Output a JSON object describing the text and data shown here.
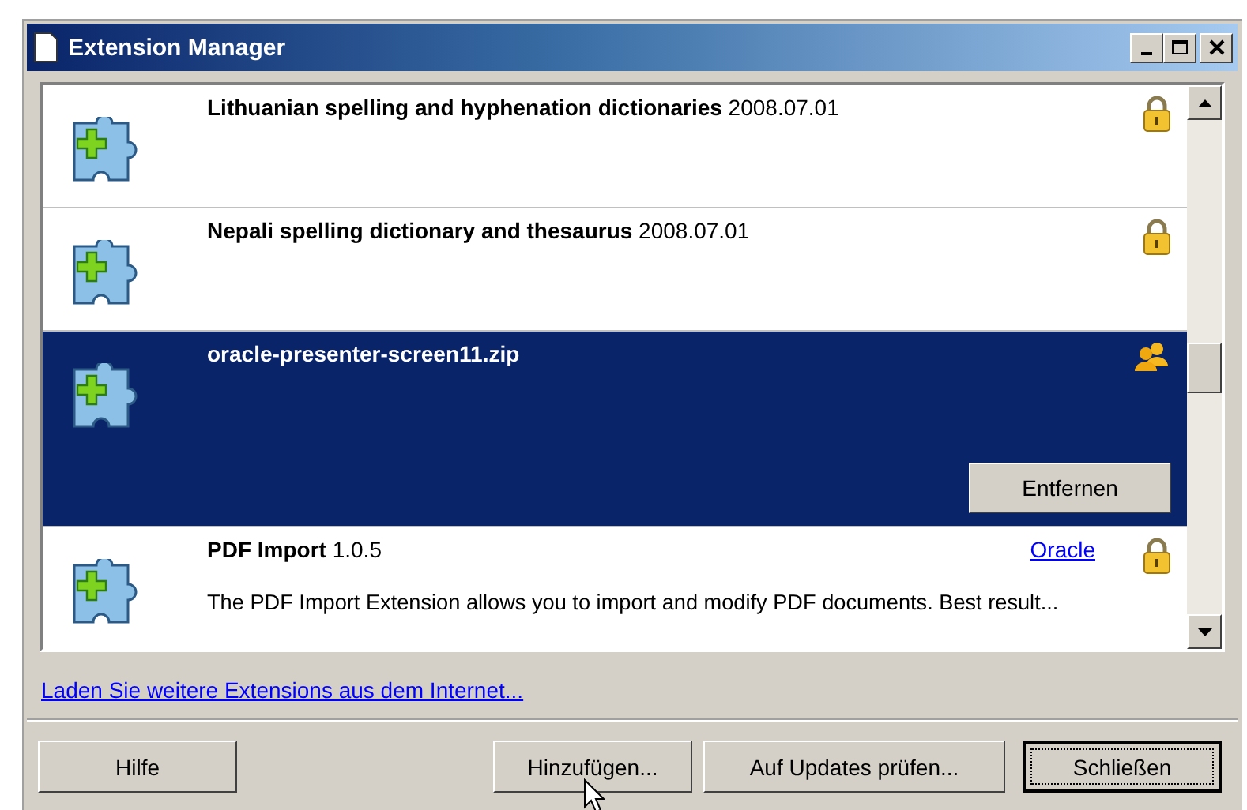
{
  "window": {
    "title": "Extension Manager"
  },
  "extensions": [
    {
      "name": "Lithuanian spelling and hyphenation dictionaries",
      "version": "2008.07.01",
      "kind": "lock",
      "selected": false
    },
    {
      "name": "Nepali spelling dictionary and thesaurus",
      "version": "2008.07.01",
      "kind": "lock",
      "selected": false
    },
    {
      "name": "oracle-presenter-screen11.zip",
      "kind": "users",
      "selected": true,
      "action": "Entfernen"
    },
    {
      "name": "PDF Import",
      "version": "1.0.5",
      "kind": "lock",
      "selected": false,
      "publisher": "Oracle",
      "description": "The PDF Import Extension allows you to import and modify PDF documents. Best result..."
    }
  ],
  "more_link": "Laden Sie weitere Extensions aus dem Internet...",
  "buttons": [
    {
      "label": "Hilfe",
      "focused": false
    },
    {
      "label": "Hinzufügen...",
      "focused": false
    },
    {
      "label": "Auf Updates prüfen...",
      "focused": false
    },
    {
      "label": "Schließen",
      "focused": true
    }
  ]
}
